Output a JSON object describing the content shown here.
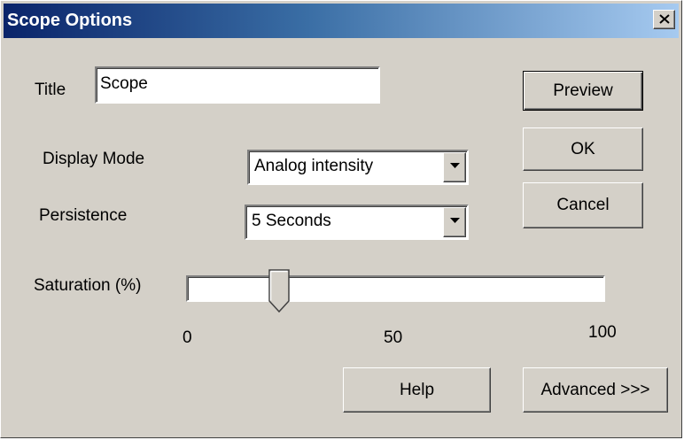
{
  "window": {
    "title": "Scope Options",
    "close_label": "Close"
  },
  "title_field": {
    "label": "Title",
    "value": "Scope"
  },
  "display_mode": {
    "label": "Display Mode",
    "selected": "Analog intensity"
  },
  "persistence": {
    "label": "Persistence",
    "selected": "5 Seconds"
  },
  "saturation": {
    "label": "Saturation (%)",
    "value_percent": 22,
    "min": 0,
    "max": 100,
    "ticks": [
      "0",
      "50",
      "100"
    ]
  },
  "buttons": {
    "preview": "Preview",
    "ok": "OK",
    "cancel": "Cancel",
    "help": "Help",
    "advanced": "Advanced >>>"
  },
  "icons": {
    "close": "close-icon",
    "dropdown": "chevron-down-icon"
  },
  "colors": {
    "face": "#d4d0c8",
    "title_gradient_start": "#0a246a",
    "title_gradient_end": "#a6caf0"
  }
}
